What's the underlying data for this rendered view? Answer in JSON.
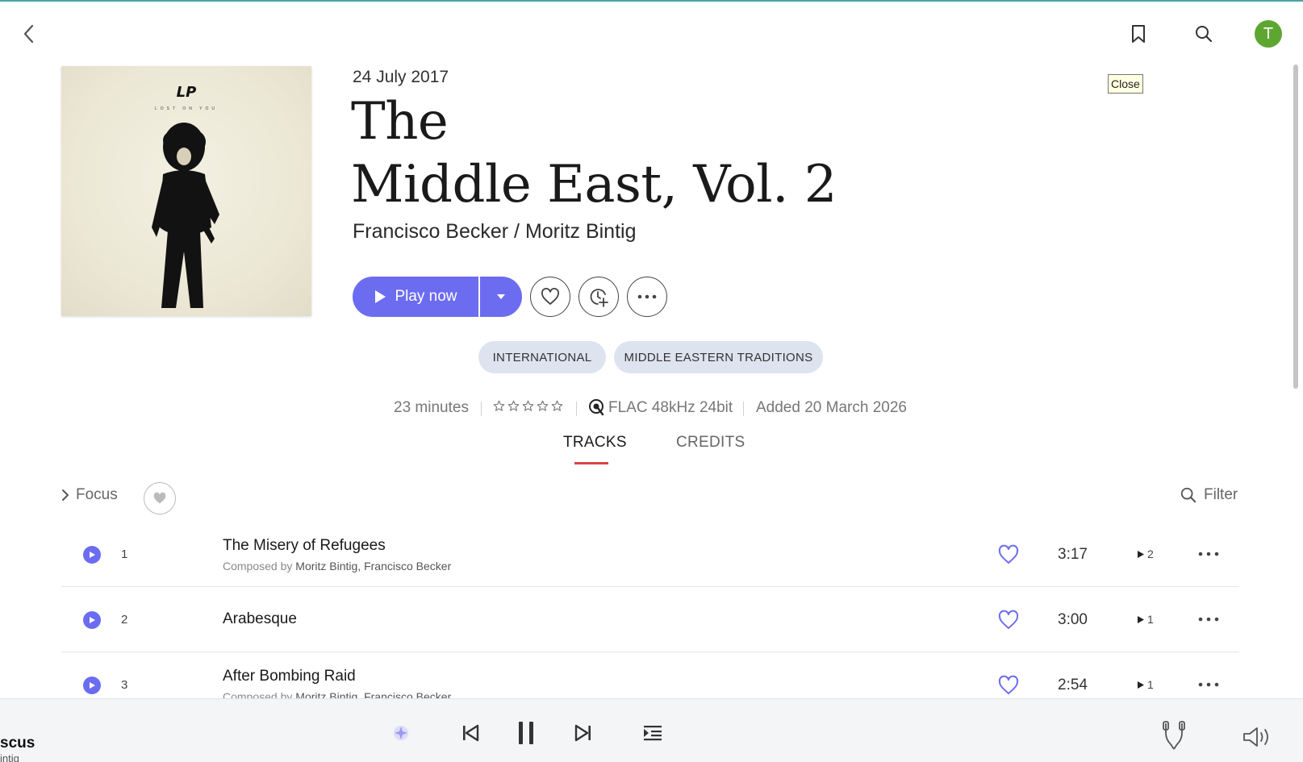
{
  "header": {
    "avatar_initial": "T",
    "tooltip": "Close"
  },
  "album": {
    "cover": {
      "artist_logo": "LP",
      "cover_subtitle": "LOST ON YOU"
    },
    "release_date": "24 July 2017",
    "title_line1": "The",
    "title_line2": "Middle East, Vol. 2",
    "artists": "Francisco Becker / Moritz Bintig"
  },
  "actions": {
    "play_label": "Play now"
  },
  "tags": [
    "INTERNATIONAL",
    "MIDDLE EASTERN TRADITIONS"
  ],
  "info": {
    "duration": "23 minutes",
    "rating_stars": 0,
    "rating_max": 5,
    "quality": "FLAC 48kHz 24bit",
    "added": "Added 20 March 2026"
  },
  "tabs": [
    {
      "label": "TRACKS",
      "active": true
    },
    {
      "label": "CREDITS",
      "active": false
    }
  ],
  "toolbar": {
    "focus_label": "Focus",
    "filter_label": "Filter"
  },
  "tracks": [
    {
      "number": "1",
      "title": "The Misery of Refugees",
      "composed_prefix": "Composed by",
      "composers": "Moritz Bintig, Francisco Becker",
      "duration": "3:17",
      "plays": "2"
    },
    {
      "number": "2",
      "title": "Arabesque",
      "composed_prefix": "",
      "composers": "",
      "duration": "3:00",
      "plays": "1"
    },
    {
      "number": "3",
      "title": "After Bombing Raid",
      "composed_prefix": "Composed by",
      "composers": "Moritz Bintig, Francisco Becker",
      "duration": "2:54",
      "plays": "1"
    }
  ],
  "player": {
    "now_playing_title": "scus",
    "now_playing_artist": "intig"
  },
  "colors": {
    "accent": "#6c6cf0",
    "tab_underline": "#d64545",
    "tag_bg": "#dde3ef",
    "avatar_bg": "#5ea632",
    "top_line": "#4aa3a0"
  },
  "icons": {
    "back": "chevron-left-icon",
    "bookmark": "bookmark-icon",
    "search": "search-icon",
    "play": "play-icon",
    "dropdown": "caret-down-icon",
    "favorite": "heart-icon",
    "add": "add-to-library-icon",
    "more": "more-dots-icon",
    "star": "star-outline-icon",
    "quality": "quality-icon",
    "radio": "radio-sparkle-icon",
    "prev": "previous-icon",
    "pause": "pause-icon",
    "next": "next-icon",
    "queue": "queue-icon",
    "mixer": "mixer-icon",
    "volume": "volume-icon"
  }
}
